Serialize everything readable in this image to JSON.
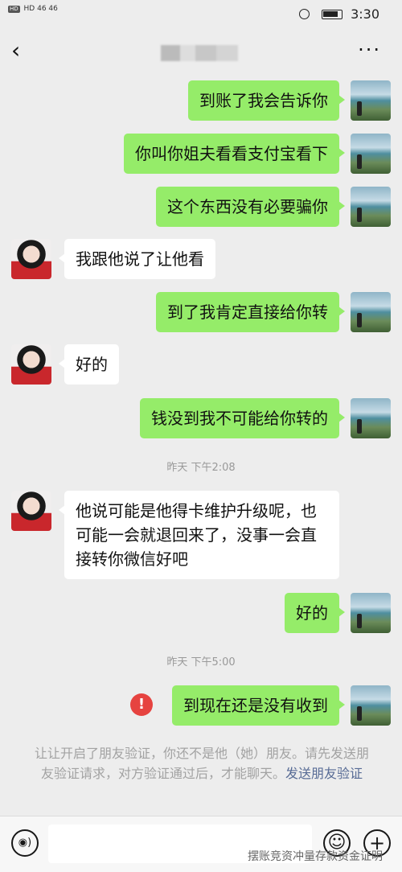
{
  "status_bar": {
    "time": "3:30",
    "left": "HD 46 46",
    "hd": "HD"
  },
  "header": {
    "back": "‹",
    "more": "···"
  },
  "messages": [
    {
      "side": "right",
      "text": "到账了我会告诉你"
    },
    {
      "side": "right",
      "text": "你叫你姐夫看看支付宝看下"
    },
    {
      "side": "right",
      "text": "这个东西没有必要骗你"
    },
    {
      "side": "left",
      "text": "我跟他说了让他看"
    },
    {
      "side": "right",
      "text": "到了我肯定直接给你转"
    },
    {
      "side": "left",
      "text": "好的"
    },
    {
      "side": "right",
      "text": "钱没到我不可能给你转的"
    },
    {
      "type": "time",
      "text": "昨天 下午2:08"
    },
    {
      "side": "left",
      "text": "他说可能是他得卡维护升级呢，也可能一会就退回来了，没事一会直接转你微信好吧"
    },
    {
      "side": "right",
      "text": "好的"
    },
    {
      "type": "time",
      "text": "昨天 下午5:00"
    },
    {
      "side": "right",
      "text": "到现在还是没有收到",
      "failed": true
    }
  ],
  "error_mark": "!",
  "system_note": {
    "text": "让让开启了朋友验证，你还不是他（她）朋友。请先发送朋友验证请求，对方验证通过后，才能聊天。",
    "link": "发送朋友验证"
  },
  "input_bar": {
    "voice_icon": "◉)",
    "emoji_icon": "☺",
    "plus_icon": "+"
  },
  "watermark": "摆账竞资冲量存款资金证明",
  "colors": {
    "bubble_right": "#95ec69",
    "bubble_left": "#ffffff",
    "background": "#ededed",
    "error": "#e64340",
    "link": "#576b95"
  }
}
